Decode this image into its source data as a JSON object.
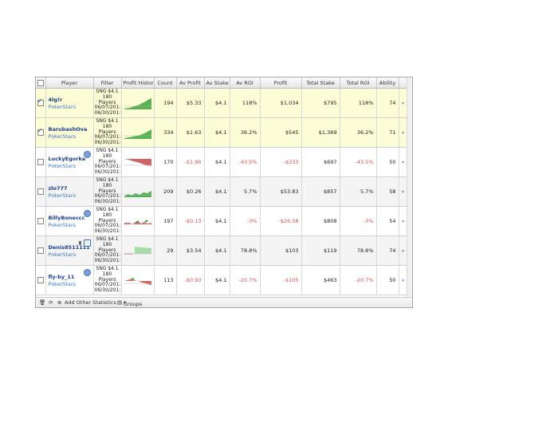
{
  "columns": {
    "player": "Player",
    "filter": "Filter",
    "profit_history": "Profit Histor",
    "count": "Count",
    "av_profit": "Av Profit",
    "av_stake": "Av Stake",
    "av_roi": "Av ROI",
    "profit": "Profit",
    "total_stake": "Total Stake",
    "total_roi": "Total ROI",
    "ability": "Ability"
  },
  "rows": [
    {
      "name": "4lg!r",
      "site": "PokerStars",
      "filter": [
        "SNG $4.1",
        "180",
        "Players",
        "06/07/201:",
        "06/30/201:"
      ],
      "count": "194",
      "av_profit": "$5.33",
      "av_stake": "$4.1",
      "av_roi": "118%",
      "profit": "$1,034",
      "total_stake": "$795",
      "total_roi": "118%",
      "ability": "74",
      "checked": true,
      "icons": [],
      "trend": "up"
    },
    {
      "name": "BarubashOva",
      "site": "PokerStars",
      "filter": [
        "SNG $4.1",
        "180",
        "Players",
        "06/07/201:",
        "06/30/201:"
      ],
      "count": "334",
      "av_profit": "$1.63",
      "av_stake": "$4.1",
      "av_roi": "36.2%",
      "profit": "$545",
      "total_stake": "$1,369",
      "total_roi": "36.2%",
      "ability": "71",
      "checked": true,
      "icons": [],
      "trend": "up2"
    },
    {
      "name": "LuckyEgorka",
      "site": "PokerStars",
      "filter": [
        "SNG $4.1",
        "180",
        "Players",
        "06/07/201:",
        "06/30/201:"
      ],
      "count": "170",
      "av_profit": "-$1.96",
      "av_stake": "$4.1",
      "av_roi": "-43.5%",
      "profit": "-$333",
      "total_stake": "$697",
      "total_roi": "-43.5%",
      "ability": "50",
      "checked": false,
      "icons": [
        "blue-avatar"
      ],
      "trend": "down"
    },
    {
      "name": "zlo777",
      "site": "PokerStars",
      "filter": [
        "SNG $4.1",
        "180",
        "Players",
        "06/07/201:",
        "06/30/201:"
      ],
      "count": "209",
      "av_profit": "$0.26",
      "av_stake": "$4.1",
      "av_roi": "5.7%",
      "profit": "$53.83",
      "total_stake": "$857",
      "total_roi": "5.7%",
      "ability": "58",
      "checked": false,
      "icons": [],
      "trend": "upflat"
    },
    {
      "name": "BillyBoneccc",
      "site": "PokerStars",
      "filter": [
        "SNG $4.1",
        "180",
        "Players",
        "06/07/201:",
        "06/30/201:"
      ],
      "count": "197",
      "av_profit": "-$0.13",
      "av_stake": "$4.1",
      "av_roi": "-3%",
      "profit": "-$26.58",
      "total_stake": "$808",
      "total_roi": "-3%",
      "ability": "54",
      "checked": false,
      "icons": [
        "blue-avatar"
      ],
      "trend": "mixed"
    },
    {
      "name": "Denis8511111",
      "site": "PokerStars",
      "filter": [
        "SNG $4.1",
        "180",
        "Players",
        "06/07/201:",
        "06/30/201:"
      ],
      "count": "29",
      "av_profit": "$3.54",
      "av_stake": "$4.1",
      "av_roi": "78.8%",
      "profit": "$103",
      "total_stake": "$119",
      "total_roi": "78.8%",
      "ability": "74",
      "checked": false,
      "icons": [
        "trophy",
        "note"
      ],
      "trend": "green-block"
    },
    {
      "name": "fly-by_11",
      "site": "PokerStars",
      "filter": [
        "SNG $4.1",
        "180",
        "Players",
        "06/07/201:",
        "06/30/201:"
      ],
      "count": "113",
      "av_profit": "-$0.93",
      "av_stake": "$4.1",
      "av_roi": "-20.7%",
      "profit": "-$105",
      "total_stake": "$463",
      "total_roi": "-20.7%",
      "ability": "50",
      "checked": false,
      "icons": [
        "blue-avatar"
      ],
      "trend": "downmix"
    }
  ],
  "footer": {
    "add_stats_label": "Add Other Statistics",
    "groups_label": "Groups"
  },
  "colors": {
    "gain": "#3aa53a",
    "loss": "#c84a4a",
    "selected_row": "#fcfcd6",
    "link": "#1a3f8f"
  }
}
